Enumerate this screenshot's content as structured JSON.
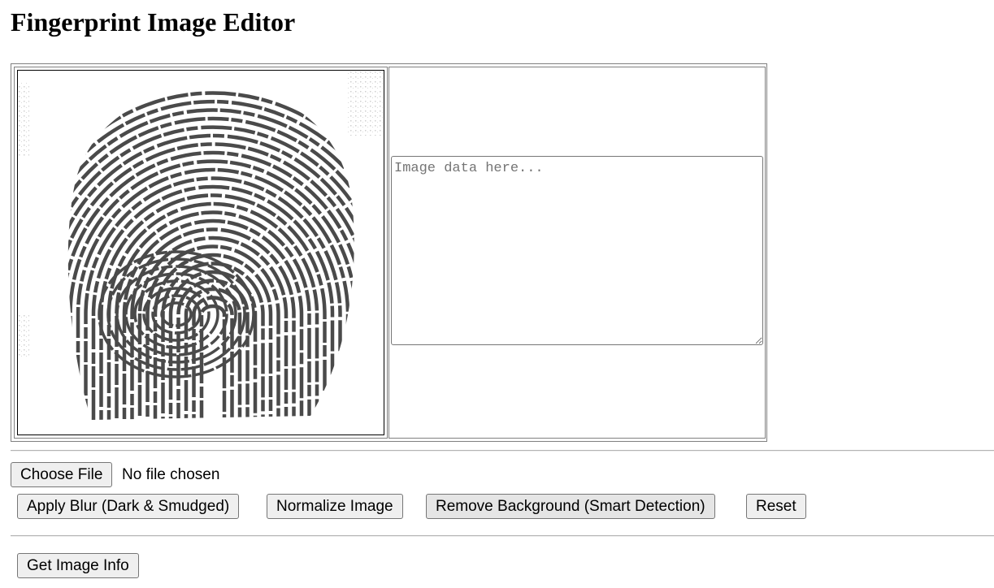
{
  "page": {
    "title": "Fingerprint Image Editor"
  },
  "editor": {
    "textarea": {
      "placeholder": "Image data here...",
      "value": ""
    }
  },
  "file_input": {
    "button_label": "Choose File",
    "status": "No file chosen"
  },
  "actions": {
    "blur_label": "Apply Blur (Dark & Smudged)",
    "normalize_label": "Normalize Image",
    "remove_bg_label": "Remove Background (Smart Detection)",
    "reset_label": "Reset"
  },
  "info": {
    "get_info_label": "Get Image Info"
  },
  "colors": {
    "ridge": "#4a4a4a",
    "noise": "#cfcfcf",
    "border": "#808080"
  },
  "icons": {
    "fingerprint": "fingerprint-image"
  }
}
